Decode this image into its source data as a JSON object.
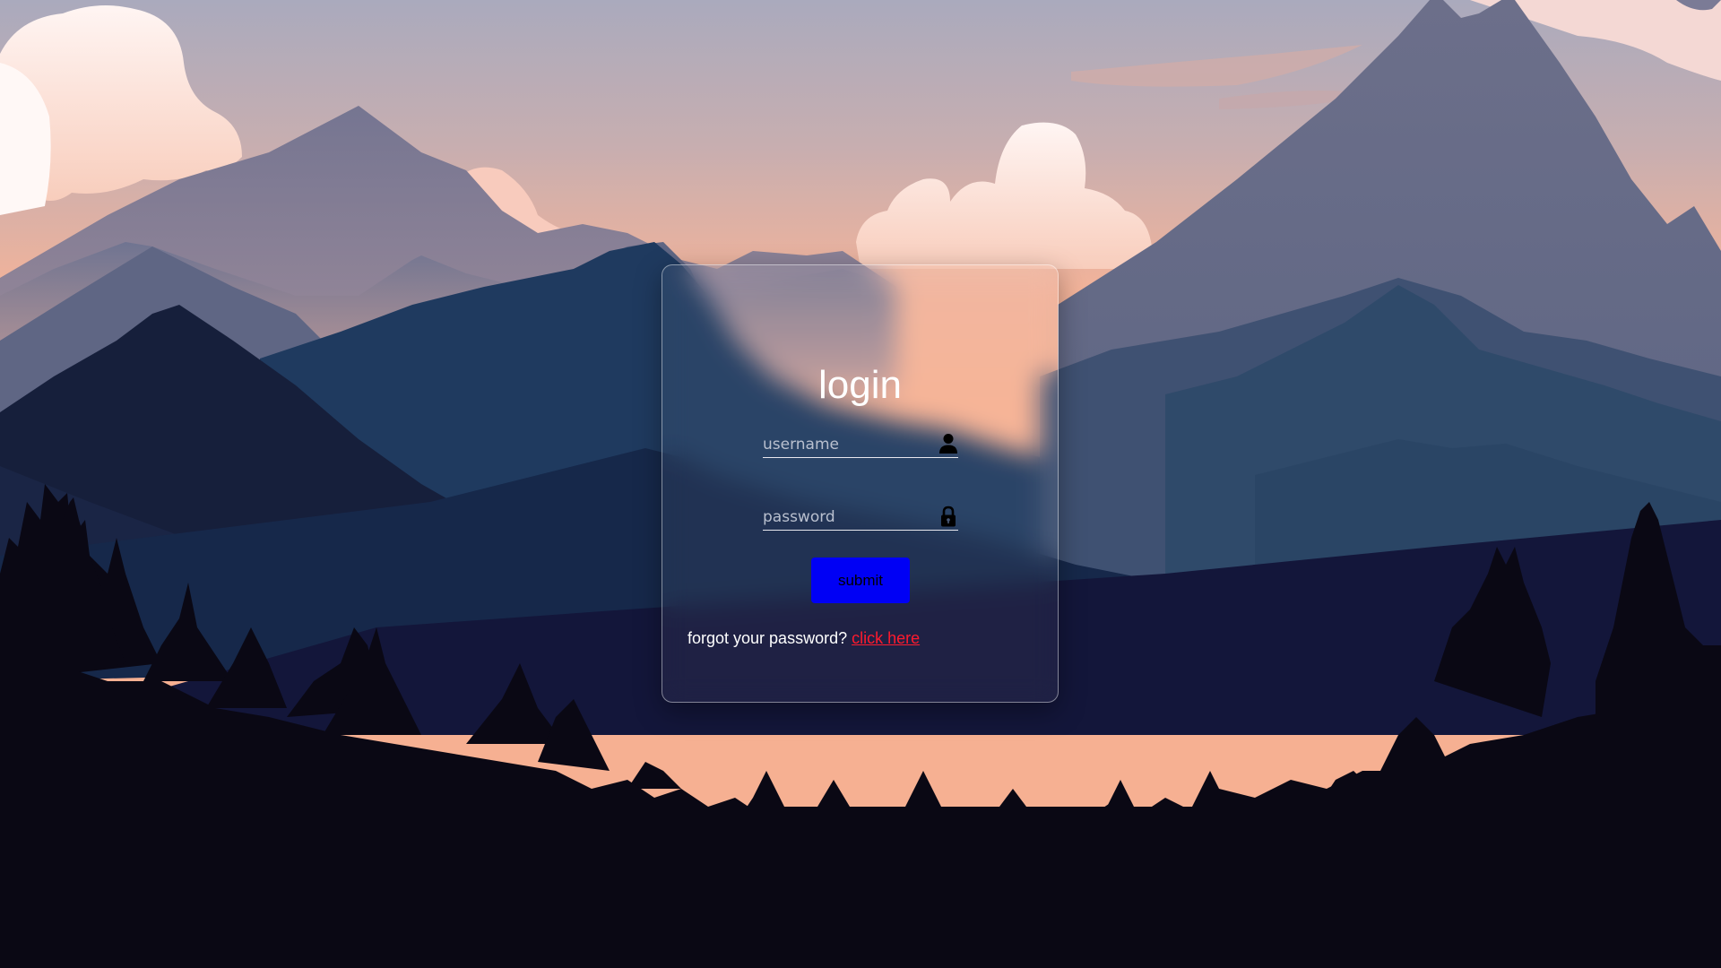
{
  "login_form": {
    "title": "login",
    "username_placeholder": "username",
    "username_value": "",
    "password_placeholder": "password",
    "password_value": "",
    "submit_label": "submit",
    "forgot_text": "forgot your password?",
    "forgot_link_label": "click here"
  },
  "icons": {
    "username_icon": "user-icon",
    "password_icon": "lock-icon"
  },
  "colors": {
    "submit_background": "#0000f5",
    "link_color": "#ff1a2e",
    "text_color": "#ffffff",
    "sky_top": "#aaaabb",
    "sky_horizon": "#f4b294",
    "forest": "#0a0814"
  }
}
